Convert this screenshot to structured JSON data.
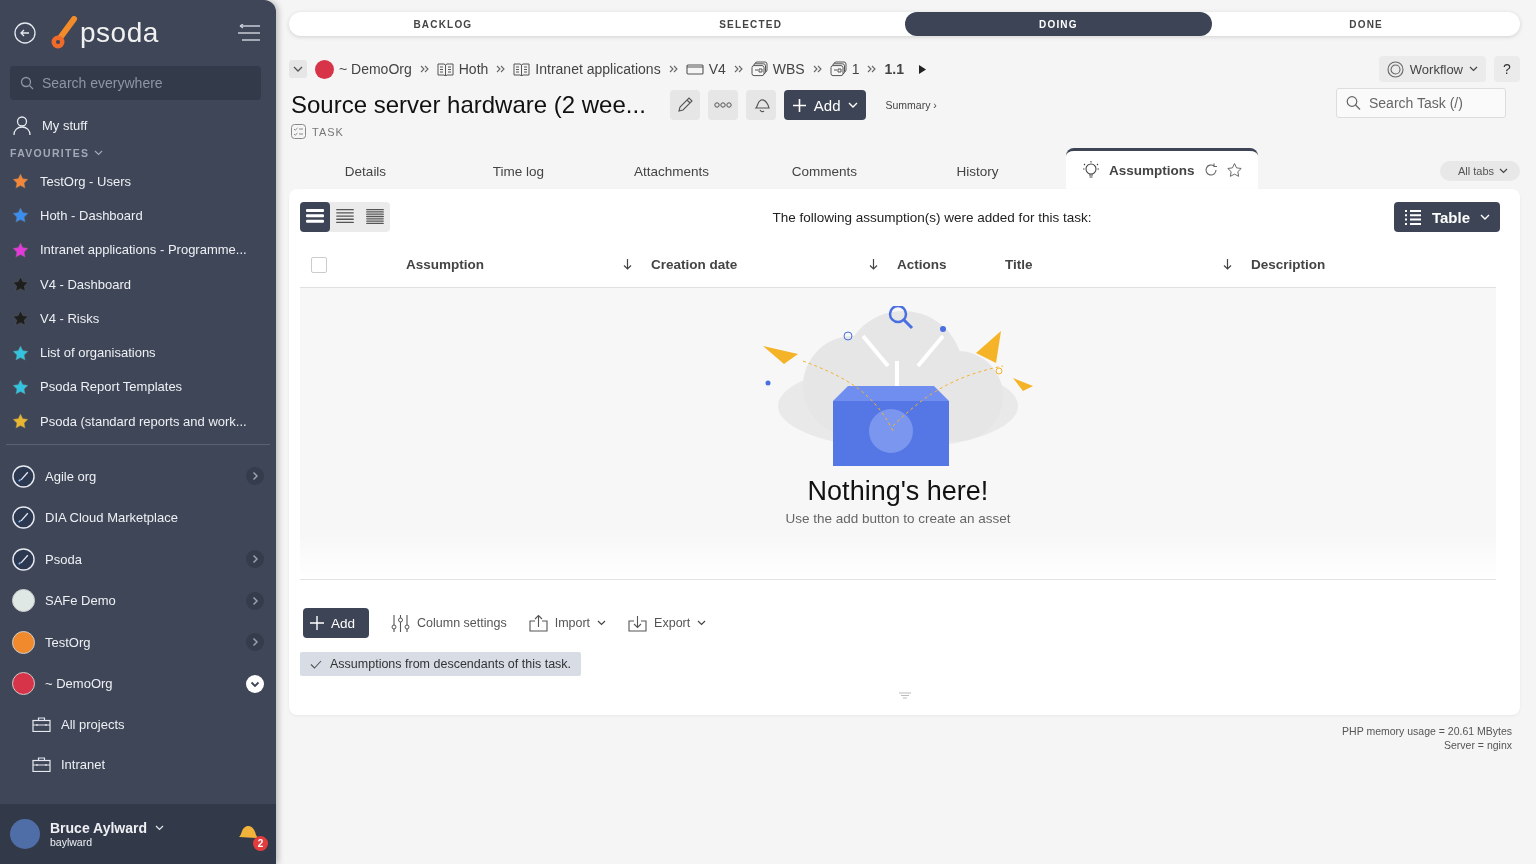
{
  "sidebar": {
    "logo": "psoda",
    "search": {
      "placeholder": "Search everywhere"
    },
    "my_stuff": "My stuff",
    "favourites_heading": "FAVOURITES",
    "favourites": [
      {
        "label": "TestOrg - Users",
        "color": "#f2873a"
      },
      {
        "label": "Hoth - Dashboard",
        "color": "#3a8ef0"
      },
      {
        "label": "Intranet applications - Programme...",
        "color": "#e23ad9"
      },
      {
        "label": "V4 - Dashboard",
        "color": "#1e1e1e"
      },
      {
        "label": "V4 - Risks",
        "color": "#1e1e1e"
      },
      {
        "label": "List of organisations",
        "color": "#33c3df"
      },
      {
        "label": "Psoda Report Templates",
        "color": "#33c3df"
      },
      {
        "label": "Psoda (standard reports and work...",
        "color": "#e8b630"
      }
    ],
    "organisations": [
      {
        "label": "Agile org",
        "kind": "rocket",
        "color": "#2c3850",
        "expanded": false
      },
      {
        "label": "DIA Cloud Marketplace",
        "kind": "rocket",
        "color": "#2c3850"
      },
      {
        "label": "Psoda",
        "kind": "rocket",
        "color": "#2c3850",
        "expanded": false
      },
      {
        "label": "SAFe Demo",
        "kind": "logo",
        "color": "#dfe8e4",
        "expanded": false
      },
      {
        "label": "TestOrg",
        "kind": "logo",
        "color": "#f08a2c",
        "expanded": false
      },
      {
        "label": "~ DemoOrg",
        "kind": "logo",
        "color": "#d7344a",
        "expanded": true,
        "children": [
          {
            "label": "All projects"
          },
          {
            "label": "Intranet"
          }
        ]
      }
    ],
    "user": {
      "name": "Bruce Aylward",
      "username": "baylward",
      "notifications": "2"
    }
  },
  "workflow_stages": [
    {
      "label": "BACKLOG",
      "selected": false
    },
    {
      "label": "SELECTED",
      "selected": false
    },
    {
      "label": "DOING",
      "selected": true
    },
    {
      "label": "DONE",
      "selected": false
    }
  ],
  "breadcrumbs": [
    {
      "label": "~ DemoOrg",
      "kind": "org"
    },
    {
      "label": "Hoth",
      "kind": "book"
    },
    {
      "label": "Intranet applications",
      "kind": "book"
    },
    {
      "label": "V4",
      "kind": "box"
    },
    {
      "label": "WBS",
      "kind": "stack"
    },
    {
      "label": "1",
      "kind": "stack"
    },
    {
      "label": "1.1",
      "kind": "current"
    }
  ],
  "page": {
    "title": "Source server hardware (2 wee...",
    "type": "TASK",
    "add_button": "Add",
    "summary_link": "Summary ›",
    "workflow_button": "Workflow",
    "help_button": "?",
    "search": {
      "placeholder": "Search Task (/)"
    }
  },
  "tabs": [
    {
      "label": "Details",
      "selected": false
    },
    {
      "label": "Time log",
      "selected": false
    },
    {
      "label": "Attachments",
      "selected": false
    },
    {
      "label": "Comments",
      "selected": false
    },
    {
      "label": "History",
      "selected": false
    },
    {
      "label": "Assumptions",
      "selected": true
    }
  ],
  "all_tabs": "All tabs",
  "panel": {
    "density_options": [
      {
        "selected": true
      },
      {
        "selected": false
      },
      {
        "selected": false
      }
    ],
    "intro": "The following assumption(s) were added for this task:",
    "view_button": "Table",
    "columns": [
      {
        "label": "Assumption",
        "sortable": true
      },
      {
        "label": "Creation date",
        "sortable": true
      },
      {
        "label": "Actions",
        "sortable": false
      },
      {
        "label": "Title",
        "sortable": true
      },
      {
        "label": "Description",
        "sortable": false
      }
    ],
    "select_all_checked": false,
    "empty_title": "Nothing's here!",
    "empty_hint": "Use the add button to create an asset",
    "toolbar": {
      "add": "Add",
      "column_settings": "Column settings",
      "import": "Import",
      "export": "Export"
    },
    "descendants_filter": {
      "label": "Assumptions from descendants of this task.",
      "checked": true
    }
  },
  "footer": [
    "PHP memory usage = 20.61 MBytes",
    "Server = nginx"
  ]
}
